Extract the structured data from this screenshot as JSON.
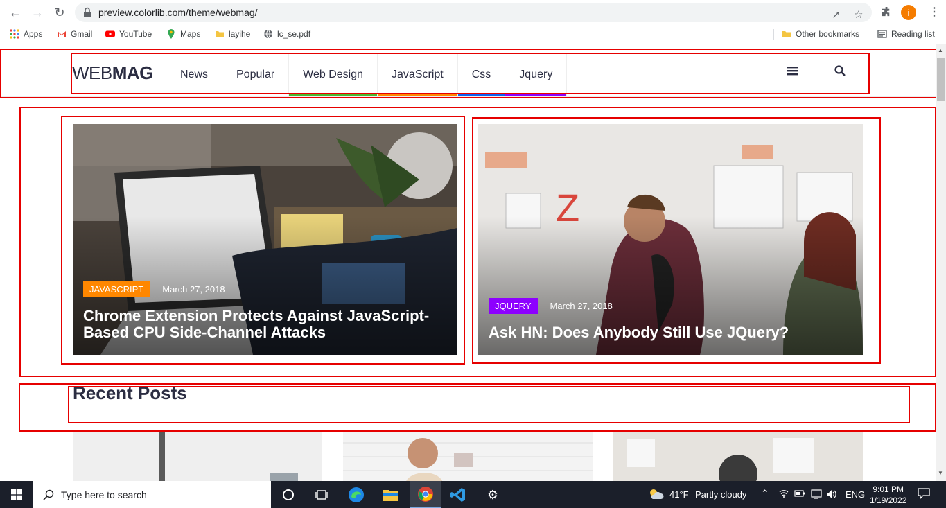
{
  "browser": {
    "url": "preview.colorlib.com/theme/webmag/",
    "avatar_letter": "i",
    "bookmarks": [
      {
        "label": "Apps",
        "icon": "apps-grid-icon"
      },
      {
        "label": "Gmail",
        "icon": "gmail-icon"
      },
      {
        "label": "YouTube",
        "icon": "youtube-icon"
      },
      {
        "label": "Maps",
        "icon": "maps-icon"
      },
      {
        "label": "layihe",
        "icon": "folder-icon"
      },
      {
        "label": "lc_se.pdf",
        "icon": "globe-icon"
      }
    ],
    "other_bookmarks": "Other bookmarks",
    "reading_list": "Reading list"
  },
  "site": {
    "logo_light": "WEB",
    "logo_bold": "MAG",
    "nav": [
      {
        "label": "News",
        "bar_color": ""
      },
      {
        "label": "Popular",
        "bar_color": ""
      },
      {
        "label": "Web Design",
        "bar_color": "#4bb92f"
      },
      {
        "label": "JavaScript",
        "bar_color": "#ff8700"
      },
      {
        "label": "Css",
        "bar_color": "#0d61f2"
      },
      {
        "label": "Jquery",
        "bar_color": "#8d00ff"
      }
    ],
    "features": [
      {
        "category": "JAVASCRIPT",
        "category_color": "#ff8700",
        "date": "March 27, 2018",
        "title_line1": "Chrome Extension Protects Against JavaScript-",
        "title_line2": "Based CPU Side-Channel Attacks"
      },
      {
        "category": "JQUERY",
        "category_color": "#8d00ff",
        "date": "March 27, 2018",
        "title_line1": "Ask HN: Does Anybody Still Use JQuery?"
      }
    ],
    "recent_posts_title": "Recent Posts"
  },
  "taskbar": {
    "search_placeholder": "Type here to search",
    "weather_temp": "41°F",
    "weather_desc": "Partly cloudy",
    "language": "ENG",
    "time": "9:01 PM",
    "date": "1/19/2022"
  }
}
